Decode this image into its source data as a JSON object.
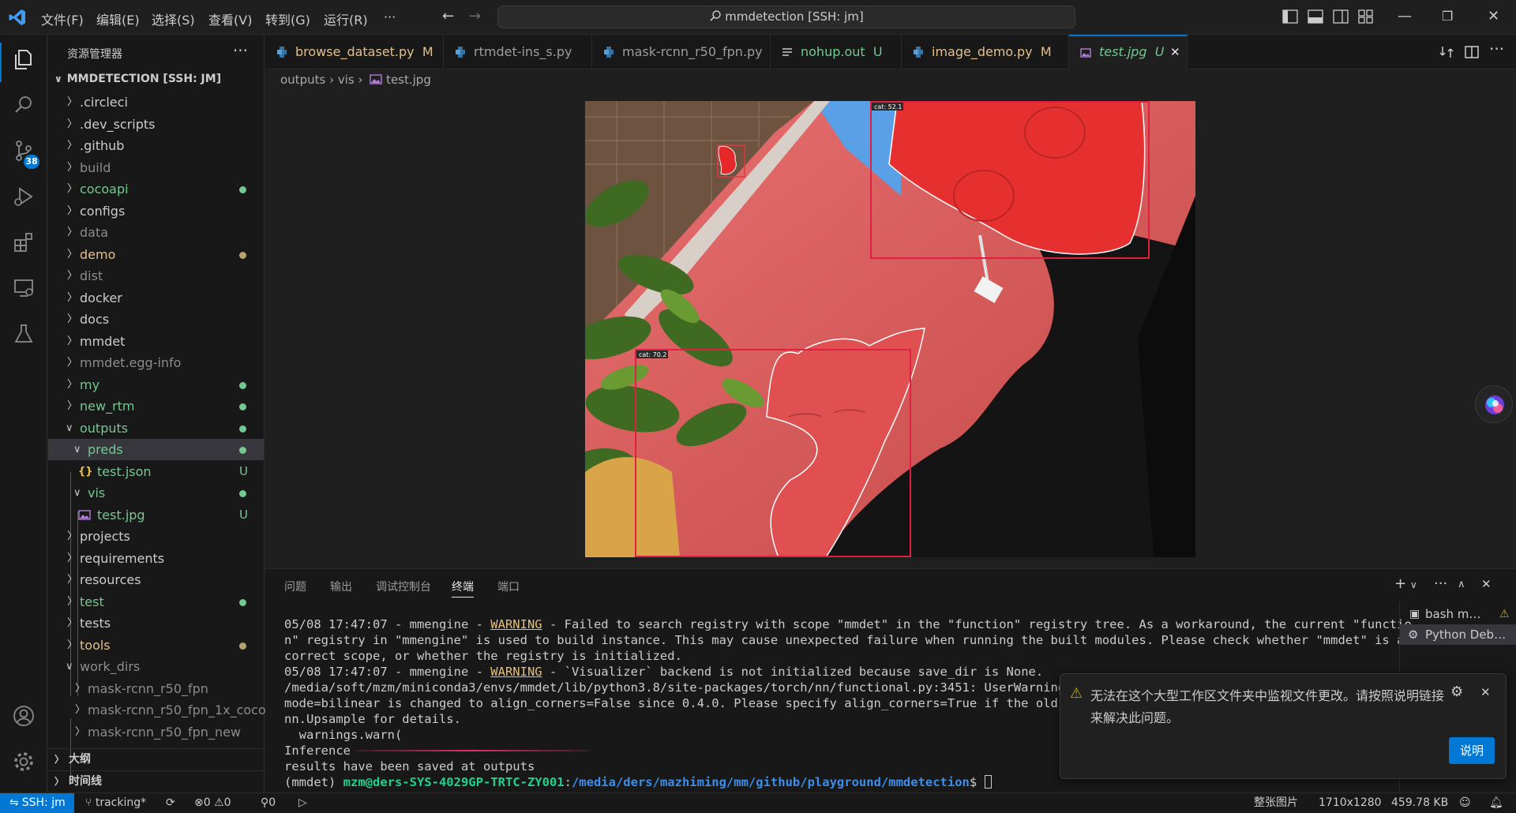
{
  "titlebar": {
    "menus": [
      "文件(F)",
      "编辑(E)",
      "选择(S)",
      "查看(V)",
      "转到(G)",
      "运行(R)",
      "···"
    ],
    "command_center": "mmdetection [SSH: jm]"
  },
  "sidebar": {
    "title": "资源管理器",
    "more": "···",
    "root": "MMDETECTION [SSH: JM]",
    "items": [
      {
        "label": "circleci"
      },
      {
        "label": "dev_scripts"
      },
      {
        "label": "github"
      },
      {
        "label": "build"
      },
      {
        "label": "cocoapi"
      },
      {
        "label": "configs"
      },
      {
        "label": "data"
      },
      {
        "label": "demo"
      },
      {
        "label": "dist"
      },
      {
        "label": "docker"
      },
      {
        "label": "docs"
      },
      {
        "label": "mmdet"
      },
      {
        "label": "mmdet.egg-info"
      },
      {
        "label": "my"
      },
      {
        "label": "new_rtm"
      },
      {
        "label": "outputs"
      },
      {
        "label": "preds"
      },
      {
        "label": "test.json",
        "decoration": "U"
      },
      {
        "label": "vis"
      },
      {
        "label": "test.jpg",
        "decoration": "U"
      },
      {
        "label": "projects"
      },
      {
        "label": "requirements"
      },
      {
        "label": "resources"
      },
      {
        "label": "test"
      },
      {
        "label": "tests"
      },
      {
        "label": "tools"
      },
      {
        "label": "work_dirs"
      },
      {
        "label": "mask-rcnn_r50_fpn"
      },
      {
        "label": "mask-rcnn_r50_fpn_1x_coco"
      },
      {
        "label": "mask-rcnn_r50_fpn_new"
      }
    ],
    "outline": "大纲",
    "timeline": "时间线"
  },
  "tabs": [
    {
      "name": "browse_dataset.py",
      "status": "M"
    },
    {
      "name": "rtmdet-ins_s.py",
      "status": ""
    },
    {
      "name": "mask-rcnn_r50_fpn.py",
      "status": ""
    },
    {
      "name": "nohup.out",
      "status": "U"
    },
    {
      "name": "image_demo.py",
      "status": "M"
    },
    {
      "name": "test.jpg",
      "status": "U",
      "close": "✕"
    }
  ],
  "breadcrumb": {
    "parts": [
      "outputs",
      "vis",
      "test.jpg"
    ],
    "sep": "›"
  },
  "image": {
    "detections": [
      {
        "label": "cat: 52.1"
      },
      {
        "label": "cat: 70.2"
      }
    ]
  },
  "panel": {
    "tabs": [
      "问题",
      "输出",
      "调试控制台",
      "终端",
      "端口"
    ],
    "active_tab": "终端",
    "terminal": {
      "l1_pre": "05/08 17:47:07 - mmengine - ",
      "warn": "WARNING",
      "l1_post": " - Failed to search registry with scope \"mmdet\" in the \"function\" registry tree. As a workaround, the current \"functio",
      "l2": "n\" registry in \"mmengine\" is used to build instance. This may cause unexpected failure when running the built modules. Please check whether \"mmdet\" is a",
      "l3": "correct scope, or whether the registry is initialized.",
      "l4_pre": "05/08 17:47:07 - mmengine - ",
      "l4_post": " - `Visualizer` backend is not initialized because save_dir is None.",
      "l5": "/media/soft/mzm/miniconda3/envs/mmdet/lib/python3.8/site-packages/torch/nn/functional.py:3451: UserWarning: D",
      "l6": "mode=bilinear is changed to align_corners=False since 0.4.0. Please specify align_corners=True if the old beh",
      "l7": "nn.Upsample for details.",
      "l8": "  warnings.warn(",
      "l9": "Inference",
      "l10": "results have been saved at outputs",
      "prompt_env": "(mmdet) ",
      "prompt_user": "mzm@ders-SYS-4029GP-TRTC-ZY001",
      "prompt_sep": ":",
      "prompt_path": "/media/ders/mazhiming/mm/github/playground/mmdetection",
      "prompt_end": "$ "
    },
    "terminal_list": [
      {
        "name": "bash m…"
      },
      {
        "name": "Python Deb…"
      }
    ]
  },
  "notification": {
    "message": "无法在这个大型工作区文件夹中监视文件更改。请按照说明链接来解决此问题。",
    "button": "说明"
  },
  "statusbar": {
    "remote": "SSH: jm",
    "branch": "tracking*",
    "errors": "0",
    "warnings": "0",
    "ports": "0",
    "image_type": "整张图片",
    "dimensions": "1710x1280",
    "size": "459.78 KB"
  },
  "colors": {
    "accent": "#0078d4",
    "untracked": "#73c991",
    "modified": "#e2c08d",
    "warning": "#e5c07b"
  }
}
